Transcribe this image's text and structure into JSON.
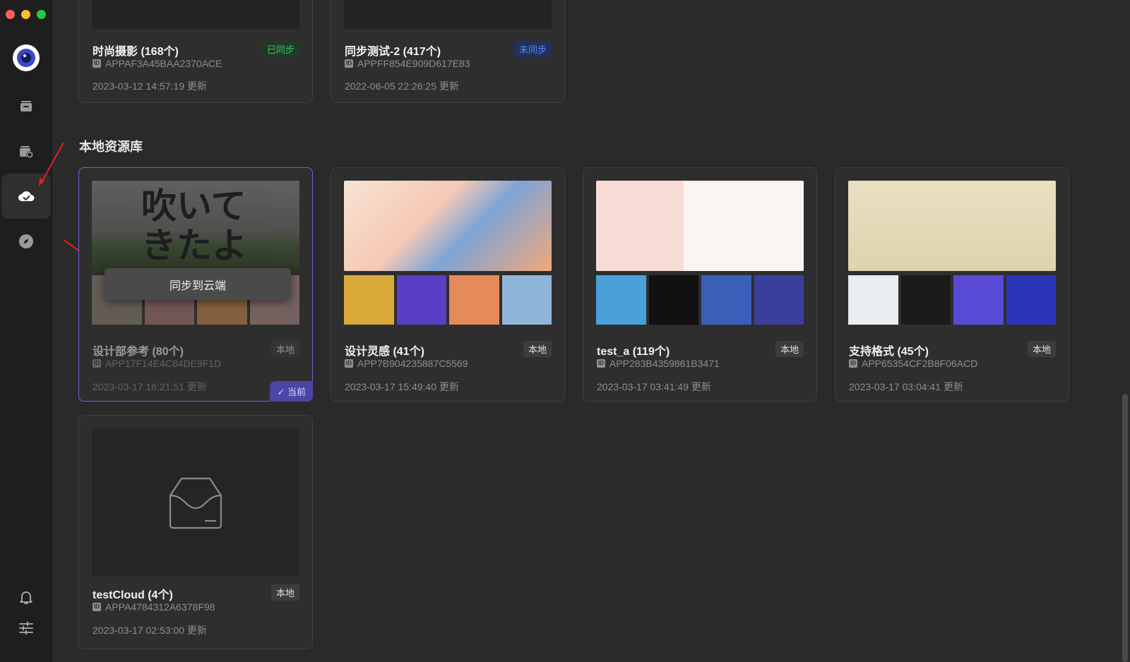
{
  "section_title": "本地资源库",
  "tooltip": "同步到云端",
  "current_label": "✓ 当前",
  "cloud_cards": [
    {
      "name": "时尚摄影 (168个)",
      "id": "APPAF3A45BAA2370ACE",
      "date": "2023-03-12 14:57:19 更新",
      "badge": "已同步"
    },
    {
      "name": "同步测试-2 (417个)",
      "id": "APPFF854E909D617E83",
      "date": "2022-06-05 22:26:25 更新",
      "badge": "未同步"
    }
  ],
  "local_cards": [
    {
      "name": "设计部参考 (80个)",
      "id": "APP17F14E4C84DE9F1D",
      "date": "2023-03-17 16:21:51 更新",
      "badge": "本地"
    },
    {
      "name": "设计灵感 (41个)",
      "id": "APP7B904235887C5569",
      "date": "2023-03-17 15:49:40 更新",
      "badge": "本地"
    },
    {
      "name": "test_a (119个)",
      "id": "APP283B4359861B3471",
      "date": "2023-03-17 03:41:49 更新",
      "badge": "本地"
    },
    {
      "name": "支持格式 (45个)",
      "id": "APP65354CF2B8F06ACD",
      "date": "2023-03-17 03:04:41 更新",
      "badge": "本地"
    },
    {
      "name": "testCloud (4个)",
      "id": "APPA4784312A6378F98",
      "date": "2023-03-17 02:53:00 更新",
      "badge": "本地"
    }
  ],
  "id_badge": "ID",
  "colors": {
    "accent": "#6a63d9",
    "synced": "#3fbf63",
    "unsynced": "#5a86f2"
  },
  "sidebar_icons": [
    "app-logo-icon",
    "library-icon",
    "cloud-library-icon",
    "cloud-check-icon",
    "compass-icon",
    "bell-icon",
    "settings-sliders-icon"
  ]
}
